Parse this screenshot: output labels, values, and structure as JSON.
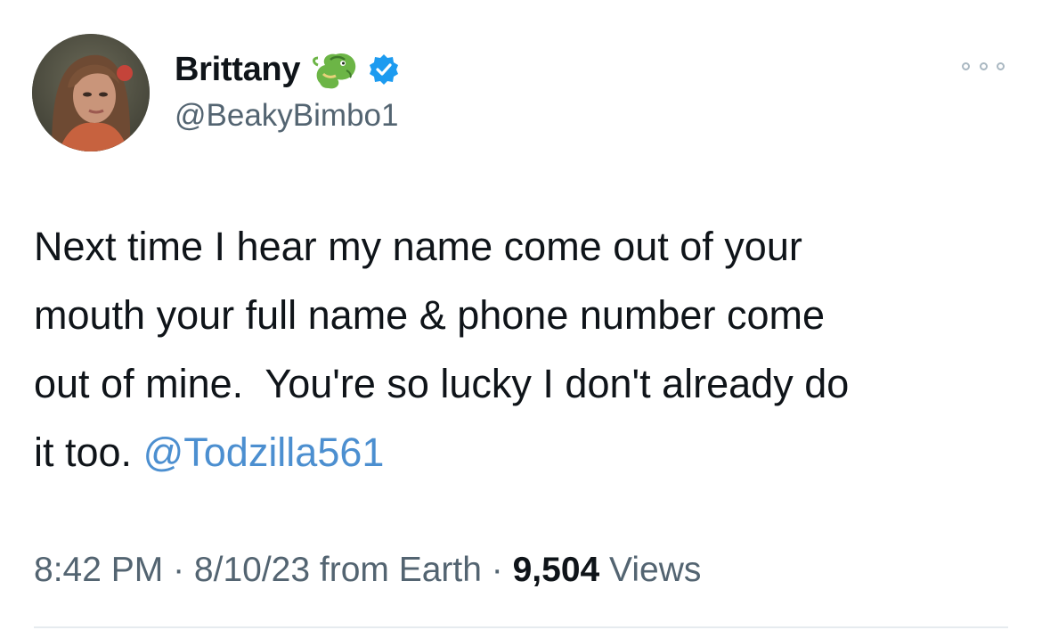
{
  "author": {
    "display_name": "Brittany",
    "handle": "@BeakyBimbo1",
    "name_emoji": "dragon-emoji",
    "verified_badge": "verified-icon",
    "badge_color": "#1d9bf0"
  },
  "tweet": {
    "text_lines": [
      "Next time I hear my name come out of your",
      "mouth your full name & phone number come",
      "out of mine.  You're so lucky I don't already do",
      "it too. "
    ],
    "mention": "@Todzilla561",
    "mention_color": "#4c8fd0"
  },
  "meta": {
    "time": "8:42 PM",
    "sep1": " · ",
    "date": "8/10/23",
    "source": " from Earth",
    "sep2": " · ",
    "views_count": "9,504",
    "views_label": " Views"
  }
}
